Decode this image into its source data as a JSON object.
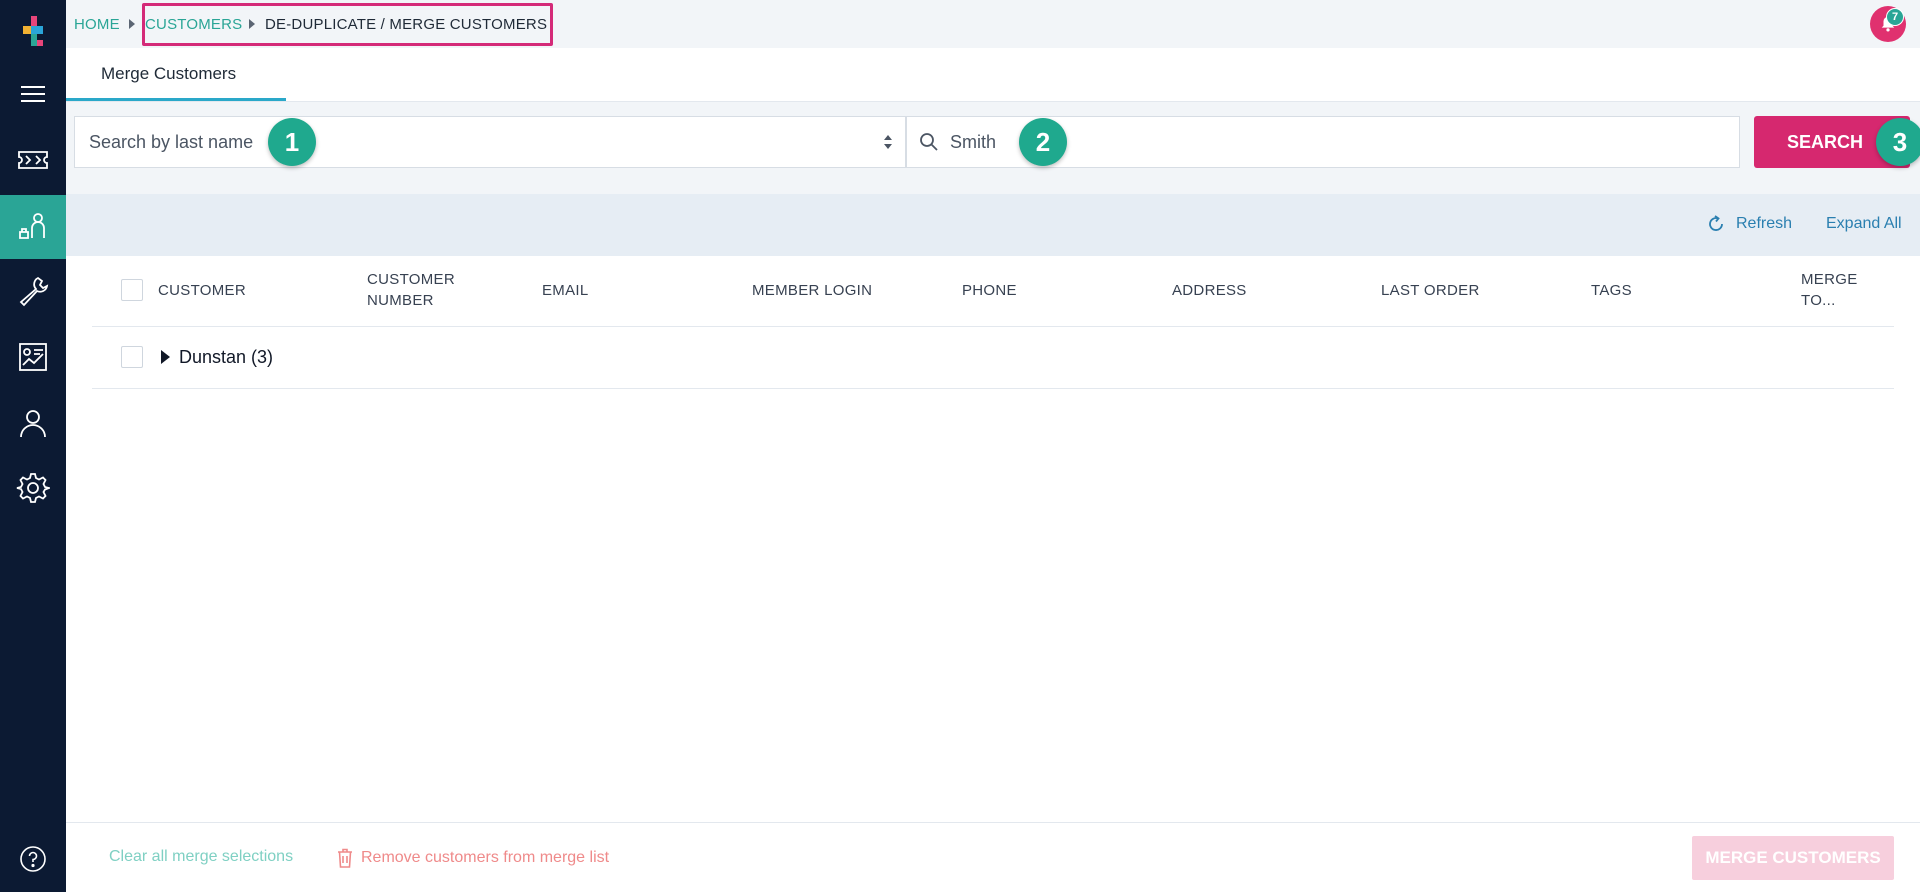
{
  "breadcrumb": {
    "home": "HOME",
    "customers": "CUSTOMERS",
    "current": "DE-DUPLICATE / MERGE CUSTOMERS"
  },
  "notifications": {
    "count": "7"
  },
  "tabs": [
    {
      "label": "Merge Customers",
      "active": true
    }
  ],
  "search": {
    "mode_placeholder": "Search by last name",
    "query": "Smith",
    "button_label": "SEARCH"
  },
  "steps": [
    "1",
    "2",
    "3"
  ],
  "toolbar": {
    "refresh_label": "Refresh",
    "expand_all_label": "Expand All"
  },
  "table": {
    "columns": {
      "customer": "CUSTOMER",
      "customer_number_1": "CUSTOMER",
      "customer_number_2": "NUMBER",
      "email": "EMAIL",
      "member_login": "MEMBER LOGIN",
      "phone": "PHONE",
      "address": "ADDRESS",
      "last_order": "LAST ORDER",
      "tags": "TAGS",
      "merge_to_1": "MERGE",
      "merge_to_2": "TO..."
    },
    "rows": [
      {
        "label": "Dunstan (3)"
      }
    ]
  },
  "footer": {
    "clear_label": "Clear all merge selections",
    "remove_label": "Remove customers from merge list",
    "merge_label": "MERGE CUSTOMERS"
  },
  "colors": {
    "sidebar": "#0c1a33",
    "accent_teal": "#2aa596",
    "brand_pink": "#d6286f",
    "link_blue": "#2a7fb0"
  },
  "icons": {
    "sidebar": [
      "menu-icon",
      "ticket-icon",
      "customers-icon",
      "tools-icon",
      "reports-icon",
      "user-icon",
      "settings-icon",
      "help-icon"
    ]
  }
}
